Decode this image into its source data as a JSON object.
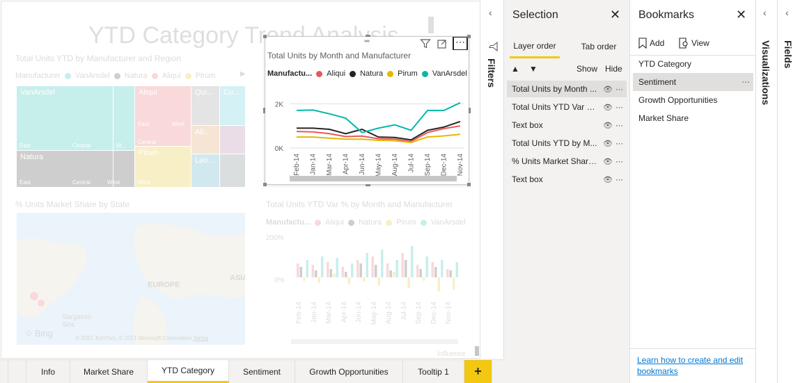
{
  "canvas": {
    "big_title": "YTD Category Trend Analysis",
    "treemap": {
      "title": "Total Units YTD by Manufacturer and Region",
      "legend_label": "Manufacturer",
      "legend": [
        "VanArsdel",
        "Natura",
        "Aliqui",
        "Pirum"
      ],
      "cells": [
        "VanArsdel",
        "Natura",
        "Aliqui",
        "Pirum",
        "Qui...",
        "Cu...",
        "Ab...",
        "Leo..."
      ],
      "subs": [
        "East",
        "Central",
        "W...",
        "East",
        "Central",
        "West",
        "East",
        "West",
        "Central",
        "West"
      ]
    },
    "map": {
      "title": "% Units Market Share by State",
      "europe": "EUROPE",
      "asia": "ASIA",
      "sea": "Sargasso Sea",
      "bing": "Bing",
      "copyright": "© 2021 TomTom, © 2021 Microsoft Corporation",
      "terms": "Terms"
    },
    "ytdvar": {
      "title": "Total Units YTD Var % by Month and Manufacturer",
      "legend_label": "Manufactu...",
      "legend": [
        "Aliqui",
        "Natura",
        "Pirum",
        "VanArsdel"
      ],
      "y_top": "200%",
      "y_mid": "0%",
      "months": [
        "Feb-14",
        "Jan-14",
        "Mar-14",
        "Apr-14",
        "Jun-14",
        "May-14",
        "Aug-14",
        "Jul-14",
        "Sep-14",
        "Dec-14",
        "Nov-14"
      ],
      "footer": "Influence"
    }
  },
  "focus_visual": {
    "title": "Total Units by Month and Manufacturer",
    "legend_label": "Manufactu...",
    "y_labels": [
      "2K",
      "0K"
    ],
    "icons": [
      "filter-icon",
      "focus-mode-icon",
      "more-options-icon"
    ]
  },
  "chart_data": {
    "type": "line",
    "title": "Total Units by Month and Manufacturer",
    "ylabel": "",
    "xlabel": "",
    "categories": [
      "Feb-14",
      "Jan-14",
      "Mar-14",
      "Apr-14",
      "Jun-14",
      "May-14",
      "Aug-14",
      "Jul-14",
      "Sep-14",
      "Dec-14",
      "Nov-14"
    ],
    "ylim": [
      0,
      2200
    ],
    "series": [
      {
        "name": "Aliqui",
        "color": "#e8585a",
        "values": [
          750,
          730,
          650,
          520,
          540,
          420,
          400,
          300,
          700,
          880,
          1000
        ]
      },
      {
        "name": "Natura",
        "color": "#252423",
        "values": [
          900,
          900,
          850,
          650,
          850,
          500,
          480,
          370,
          800,
          950,
          1200
        ]
      },
      {
        "name": "Pirum",
        "color": "#e6b800",
        "values": [
          500,
          500,
          450,
          400,
          400,
          350,
          330,
          250,
          500,
          550,
          620
        ]
      },
      {
        "name": "VanArsdel",
        "color": "#01b8aa",
        "values": [
          1700,
          1720,
          1550,
          1350,
          700,
          900,
          1050,
          800,
          1700,
          1700,
          2050
        ]
      }
    ]
  },
  "filters": {
    "label": "Filters"
  },
  "selection": {
    "title": "Selection",
    "tabs": [
      "Layer order",
      "Tab order"
    ],
    "show": "Show",
    "hide": "Hide",
    "items": [
      "Total Units by Month ...",
      "Total Units YTD Var %...",
      "Text box",
      "Total Units YTD by M...",
      "% Units Market Share...",
      "Text box"
    ]
  },
  "bookmarks": {
    "title": "Bookmarks",
    "add": "Add",
    "view": "View",
    "items": [
      "YTD Category",
      "Sentiment",
      "Growth Opportunities",
      "Market Share"
    ],
    "link": "Learn how to create and edit bookmarks"
  },
  "visualizations": {
    "label": "Visualizations"
  },
  "fields": {
    "label": "Fields"
  },
  "tabs": {
    "items": [
      "Info",
      "Market Share",
      "YTD Category",
      "Sentiment",
      "Growth Opportunities",
      "Tooltip 1"
    ],
    "add": "+"
  },
  "colors": {
    "accent": "#f2c811",
    "vanarsdel": "#01b8aa",
    "natura": "#252423",
    "aliqui": "#e8585a",
    "pirum": "#e6b800"
  }
}
